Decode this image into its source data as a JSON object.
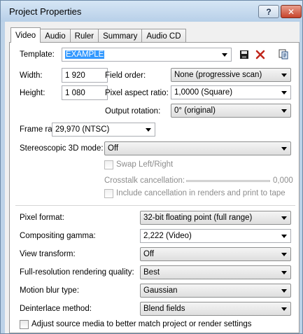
{
  "window": {
    "title": "Project Properties",
    "help_label": "?",
    "close_label": "✕"
  },
  "tabs": [
    "Video",
    "Audio",
    "Ruler",
    "Summary",
    "Audio CD"
  ],
  "template": {
    "label": "Template:",
    "value": "EXAMPLE"
  },
  "width": {
    "label": "Width:",
    "value": "1 920"
  },
  "height": {
    "label": "Height:",
    "value": "1 080"
  },
  "field_order": {
    "label": "Field order:",
    "value": "None (progressive scan)"
  },
  "pixel_aspect": {
    "label": "Pixel aspect ratio:",
    "value": "1,0000 (Square)"
  },
  "output_rotation": {
    "label": "Output rotation:",
    "value": "0° (original)"
  },
  "frame_rate": {
    "label": "Frame rate:",
    "value": "29,970 (NTSC)"
  },
  "stereo_mode": {
    "label": "Stereoscopic 3D mode:",
    "value": "Off"
  },
  "swap_lr": {
    "label": "Swap Left/Right"
  },
  "crosstalk": {
    "label": "Crosstalk cancellation:",
    "value": "0,000"
  },
  "include_cancel": {
    "label": "Include cancellation in renders and print to tape"
  },
  "pixel_format": {
    "label": "Pixel format:",
    "value": "32-bit floating point (full range)"
  },
  "compositing_gamma": {
    "label": "Compositing gamma:",
    "value": "2,222 (Video)"
  },
  "view_transform": {
    "label": "View transform:",
    "value": "Off"
  },
  "render_quality": {
    "label": "Full-resolution rendering quality:",
    "value": "Best"
  },
  "motion_blur": {
    "label": "Motion blur type:",
    "value": "Gaussian"
  },
  "deinterlace": {
    "label": "Deinterlace method:",
    "value": "Blend fields"
  },
  "adjust_source": {
    "label": "Adjust source media to better match project or render settings"
  }
}
